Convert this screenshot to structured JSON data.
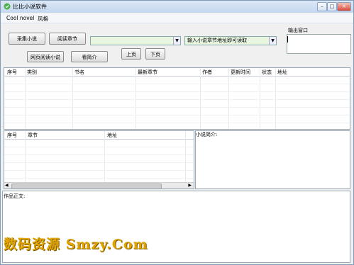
{
  "window": {
    "title": "比比小说软件",
    "minimize": "–",
    "maximize": "□",
    "close": "✕"
  },
  "menu": [
    {
      "label": "Cool novel"
    },
    {
      "label": "风格"
    }
  ],
  "toolbar": {
    "collect_btn": "采集小说",
    "read_chapter_btn": "阅读章节",
    "web_read_btn": "网页阅读小说",
    "intro_btn": "看简介",
    "prev_btn": "上页",
    "next_btn": "下页",
    "url_hint": "输入小说章节地址即可读取"
  },
  "output": {
    "label": "输出窗口"
  },
  "novel_table": {
    "headers": [
      "序号",
      "类别",
      "书名",
      "最新章节",
      "作者",
      "更新时间",
      "状态",
      "地址"
    ]
  },
  "chapter_table": {
    "headers": [
      "序号",
      "章节",
      "地址"
    ]
  },
  "intro_pane": {
    "label": "小说简介:"
  },
  "content_pane": {
    "label": "作品正文:"
  },
  "watermark": {
    "text": "数码资源 Smzy.Com"
  }
}
